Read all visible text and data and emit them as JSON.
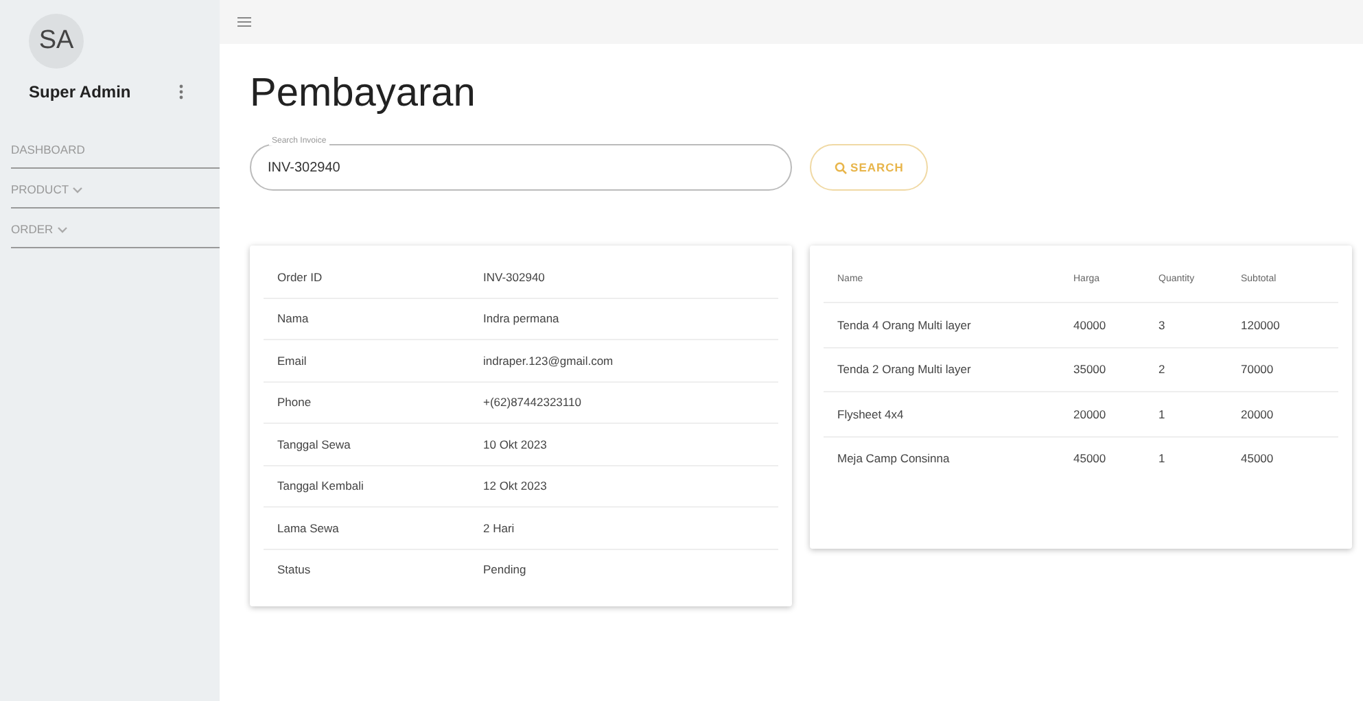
{
  "sidebar": {
    "avatar": "SA",
    "user": "Super Admin",
    "items": [
      {
        "label": "DASHBOARD",
        "kind": "link"
      },
      {
        "label": "PRODUCT",
        "kind": "dropdown"
      },
      {
        "label": "ORDER",
        "kind": "dropdown"
      }
    ]
  },
  "page": {
    "title": "Pembayaran"
  },
  "search": {
    "label": "Search Invoice",
    "value": "INV-302940",
    "button": "SEARCH"
  },
  "details": [
    {
      "label": "Order ID",
      "value": "INV-302940"
    },
    {
      "label": "Nama",
      "value": "Indra permana"
    },
    {
      "label": "Email",
      "value": "indraper.123@gmail.com"
    },
    {
      "label": "Phone",
      "value": "+(62)87442323110"
    },
    {
      "label": "Tanggal Sewa",
      "value": "10 Okt 2023"
    },
    {
      "label": "Tanggal Kembali",
      "value": "12 Okt 2023"
    },
    {
      "label": "Lama Sewa",
      "value": "2 Hari"
    },
    {
      "label": "Status",
      "value": "Pending"
    }
  ],
  "table": {
    "columns": [
      "Name",
      "Harga",
      "Quantity",
      "Subtotal"
    ],
    "rows": [
      [
        "Tenda 4 Orang Multi layer",
        "40000",
        "3",
        "120000"
      ],
      [
        "Tenda 2 Orang Multi layer",
        "35000",
        "2",
        "70000"
      ],
      [
        "Flysheet 4x4",
        "20000",
        "1",
        "20000"
      ],
      [
        "Meja Camp Consinna",
        "45000",
        "1",
        "45000"
      ]
    ]
  }
}
